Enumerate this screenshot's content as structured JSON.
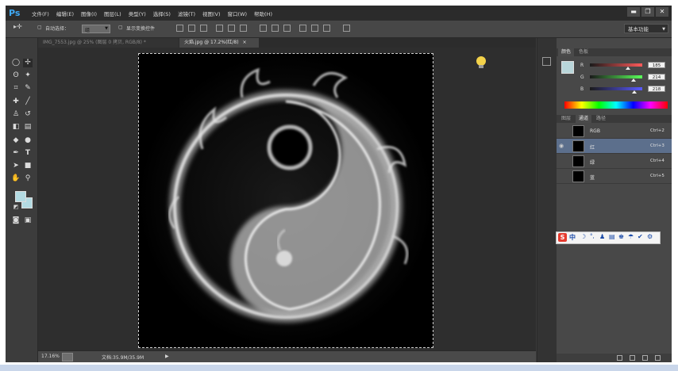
{
  "app": {
    "logo": "Ps"
  },
  "menu": [
    "文件(F)",
    "编辑(E)",
    "图像(I)",
    "图层(L)",
    "类型(Y)",
    "选择(S)",
    "滤镜(T)",
    "视图(V)",
    "窗口(W)",
    "帮助(H)"
  ],
  "window_controls": {
    "minimize": "▬",
    "restore": "❐",
    "close": "✕"
  },
  "options_bar": {
    "auto_select_label": "自动选择：",
    "auto_select_value": "组",
    "show_transform_label": "显示变换控件",
    "workspace": "基本功能"
  },
  "document_tabs": [
    {
      "label": "IMG_7553.jpg @ 25% (图层 0 拷贝, RGB/8) *",
      "active": false
    },
    {
      "label": "火焰.jpg @ 17.2%(红/8)",
      "active": true
    }
  ],
  "tools_icons": [
    "marquee-icon",
    "move-icon",
    "lasso-icon",
    "magic-wand-icon",
    "crop-icon",
    "eyedropper-icon",
    "healing-icon",
    "brush-icon",
    "stamp-icon",
    "history-brush-icon",
    "eraser-icon",
    "gradient-icon",
    "blur-icon",
    "dodge-icon",
    "pen-icon",
    "type-icon",
    "path-select-icon",
    "shape-icon",
    "hand-icon",
    "zoom-icon"
  ],
  "status_bar": {
    "zoom": "17.16%",
    "doc_info": "文档:35.9M/35.9M"
  },
  "color_panel": {
    "tabs": [
      "颜色",
      "色板"
    ],
    "sliders": [
      {
        "label": "R",
        "value": "185",
        "gradient_color": "#ff5a5a",
        "position": 0.72
      },
      {
        "label": "G",
        "value": "214",
        "gradient_color": "#5aff5a",
        "position": 0.84
      },
      {
        "label": "B",
        "value": "218",
        "gradient_color": "#5a5aff",
        "position": 0.85
      }
    ],
    "swatch_color": "#b9d6da"
  },
  "channels_panel": {
    "tabs": [
      "图层",
      "通道",
      "路径"
    ],
    "active_tab": 1,
    "rows": [
      {
        "name": "RGB",
        "shortcut": "Ctrl+2",
        "visible": false,
        "selected": false
      },
      {
        "name": "红",
        "shortcut": "Ctrl+3",
        "visible": true,
        "selected": true
      },
      {
        "name": "绿",
        "shortcut": "Ctrl+4",
        "visible": false,
        "selected": false
      },
      {
        "name": "蓝",
        "shortcut": "Ctrl+5",
        "visible": false,
        "selected": false
      }
    ]
  },
  "ime_toolbar": {
    "logo": "S",
    "mode": "中",
    "items": [
      "☽",
      "°,",
      "♟",
      "▤",
      "♚",
      "☂",
      "✔",
      "⚙"
    ]
  },
  "colors": {
    "accent": "#3fa9f5",
    "selection": "#5c6f8c",
    "workspace": "#3a3a3a"
  }
}
